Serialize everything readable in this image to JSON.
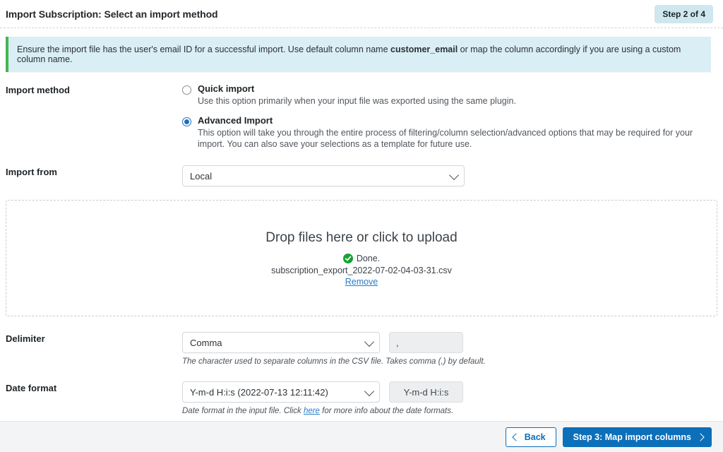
{
  "header": {
    "title": "Import Subscription: Select an import method",
    "step_badge": "Step 2 of 4"
  },
  "notice": {
    "text_before": "Ensure the import file has the user's email ID for a successful import. Use default column name ",
    "highlight": "customer_email",
    "text_after": " or map the column accordingly if you are using a custom column name."
  },
  "import_method": {
    "label": "Import method",
    "options": [
      {
        "title": "Quick import",
        "description": "Use this option primarily when your input file was exported using the same plugin.",
        "selected": false
      },
      {
        "title": "Advanced Import",
        "description": "This option will take you through the entire process of filtering/column selection/advanced options that may be required for your import. You can also save your selections as a template for future use.",
        "selected": true
      }
    ]
  },
  "import_from": {
    "label": "Import from",
    "value": "Local"
  },
  "dropzone": {
    "title": "Drop files here or click to upload",
    "status": "Done.",
    "filename": "subscription_export_2022-07-02-04-03-31.csv",
    "remove_label": "Remove"
  },
  "delimiter": {
    "label": "Delimiter",
    "value": "Comma",
    "character": ",",
    "hint": "The character used to separate columns in the CSV file. Takes comma (,) by default."
  },
  "date_format": {
    "label": "Date format",
    "value": "Y-m-d H:i:s (2022-07-13 12:11:42)",
    "preview": "Y-m-d H:i:s",
    "hint_before": "Date format in the input file. Click ",
    "hint_link": "here",
    "hint_after": " for more info about the date formats."
  },
  "footer": {
    "back_label": "Back",
    "next_label": "Step 3: Map import columns"
  },
  "colors": {
    "primary": "#0c6fba",
    "notice_bg": "#d9eef5",
    "notice_accent": "#46b450",
    "badge_bg": "#cfe7ef",
    "success": "#46b450",
    "link": "#2a7cc7"
  }
}
